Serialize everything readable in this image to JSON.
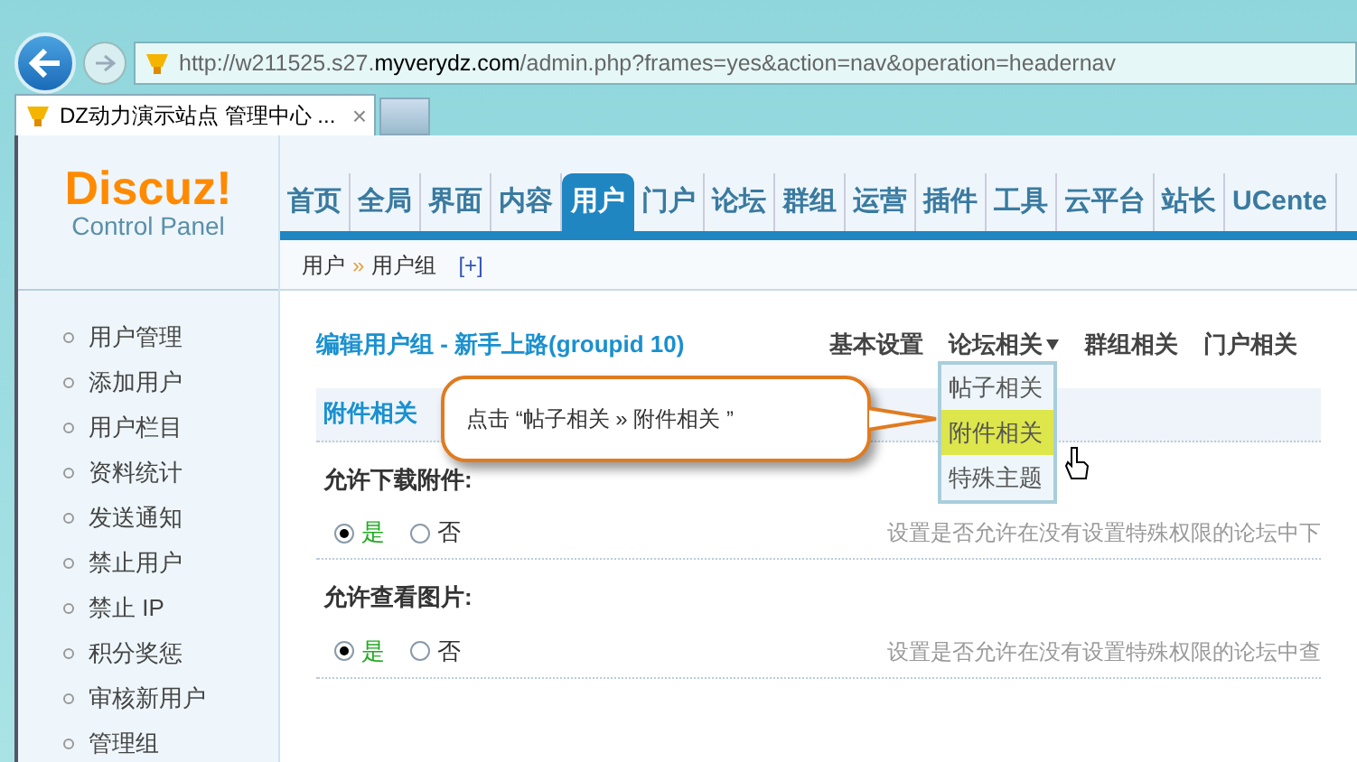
{
  "browser": {
    "url_prefix": "http://w211525.s27.",
    "url_domain": "myverydz.com",
    "url_suffix": "/admin.php?frames=yes&action=nav&operation=headernav",
    "tab_title": "DZ动力演示站点 管理中心 ...",
    "tab_close": "×"
  },
  "logo": {
    "name": "Discuz!",
    "subtitle": "Control Panel"
  },
  "nav": [
    {
      "label": "首页",
      "selected": false
    },
    {
      "label": "全局",
      "selected": false
    },
    {
      "label": "界面",
      "selected": false
    },
    {
      "label": "内容",
      "selected": false
    },
    {
      "label": "用户",
      "selected": true
    },
    {
      "label": "门户",
      "selected": false
    },
    {
      "label": "论坛",
      "selected": false
    },
    {
      "label": "群组",
      "selected": false
    },
    {
      "label": "运营",
      "selected": false
    },
    {
      "label": "插件",
      "selected": false
    },
    {
      "label": "工具",
      "selected": false
    },
    {
      "label": "云平台",
      "selected": false
    },
    {
      "label": "站长",
      "selected": false
    },
    {
      "label": "UCente",
      "selected": false
    }
  ],
  "breadcrumb": {
    "items": [
      "用户",
      "用户组"
    ],
    "separator": "»",
    "add": "[+]"
  },
  "sidebar": {
    "items": [
      "用户管理",
      "添加用户",
      "用户栏目",
      "资料统计",
      "发送通知",
      "禁止用户",
      "禁止 IP",
      "积分奖惩",
      "审核新用户",
      "管理组"
    ]
  },
  "page_title": "编辑用户组 - 新手上路(groupid 10)",
  "subtabs": [
    {
      "label": "基本设置",
      "dropdown": false
    },
    {
      "label": "论坛相关",
      "dropdown": true
    },
    {
      "label": "群组相关",
      "dropdown": false
    },
    {
      "label": "门户相关",
      "dropdown": false
    }
  ],
  "dropdown": {
    "items": [
      {
        "label": "帖子相关",
        "selected": false
      },
      {
        "label": "附件相关",
        "selected": true
      },
      {
        "label": "特殊主题",
        "selected": false
      }
    ]
  },
  "callout": "点击 “帖子相关 » 附件相关 ”",
  "section": "附件相关",
  "settings": [
    {
      "label": "允许下载附件:",
      "options": [
        {
          "label": "是",
          "checked": true
        },
        {
          "label": "否",
          "checked": false
        }
      ],
      "description": "设置是否允许在没有设置特殊权限的论坛中下"
    },
    {
      "label": "允许查看图片:",
      "options": [
        {
          "label": "是",
          "checked": true
        },
        {
          "label": "否",
          "checked": false
        }
      ],
      "description": "设置是否允许在没有设置特殊权限的论坛中查"
    }
  ]
}
